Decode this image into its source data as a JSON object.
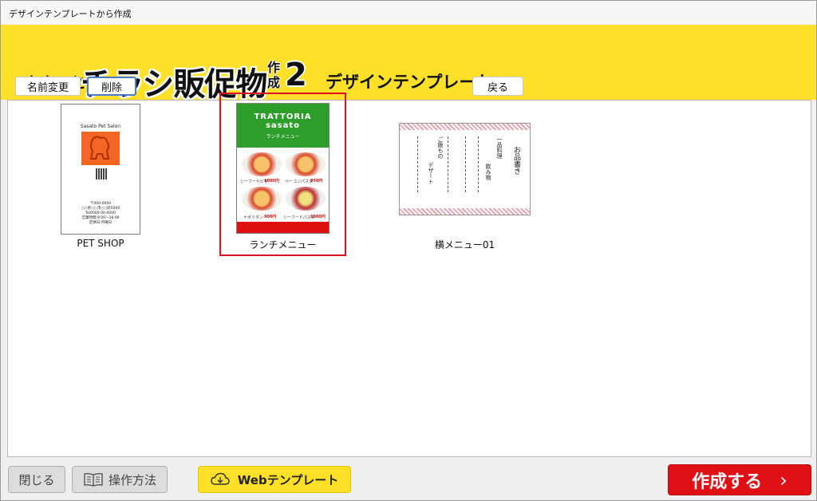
{
  "window": {
    "title": "デザインテンプレートから作成"
  },
  "header": {
    "logo_small": "ささっと",
    "logo_main": "チラシ販促物",
    "logo_sub": "作成",
    "logo_num": "2",
    "heading": "デザインテンプレート"
  },
  "toolbar": {
    "rename_label": "名前変更",
    "delete_label": "削除",
    "back_label": "戻る"
  },
  "templates": [
    {
      "caption": "PET SHOP",
      "thumb_title": "Sasato Pet Salon",
      "thumb_addr_1": "〒000-0000",
      "thumb_addr_2": "○○県○○市○○町0000",
      "thumb_addr_3": "Tel0000-00-0000",
      "thumb_addr_4": "営業時間:9:00～18:00",
      "thumb_addr_5": "定休日:月曜日",
      "selected": false
    },
    {
      "caption": "ランチメニュー",
      "thumb_title": "TRATTORIA",
      "thumb_subtitle": "sasato",
      "thumb_lunch": "ランチメニュー",
      "price_1": "1000円",
      "price_2": "950円",
      "price_3": "900円",
      "price_4": "1000円",
      "item_1": "シーフードピザ",
      "item_2": "ベーコンパスタ",
      "item_3": "ナポリタン",
      "item_4": "シーフードパスタ",
      "selected": true
    },
    {
      "caption": "横メニュー01",
      "thumb_title": "お品書き",
      "thumb_col_1": "一品料理",
      "thumb_col_2": "飲み物",
      "thumb_col_3": "ご飯もの",
      "thumb_col_4": "デザート",
      "selected": false
    }
  ],
  "footer": {
    "close_label": "閉じる",
    "manual_label": "操作方法",
    "web_label": "Webテンプレート",
    "create_label": "作成する",
    "create_arrow": "›"
  },
  "colors": {
    "header_bg": "#fde027",
    "selection": "#e0101e",
    "create_btn": "#e11017"
  }
}
